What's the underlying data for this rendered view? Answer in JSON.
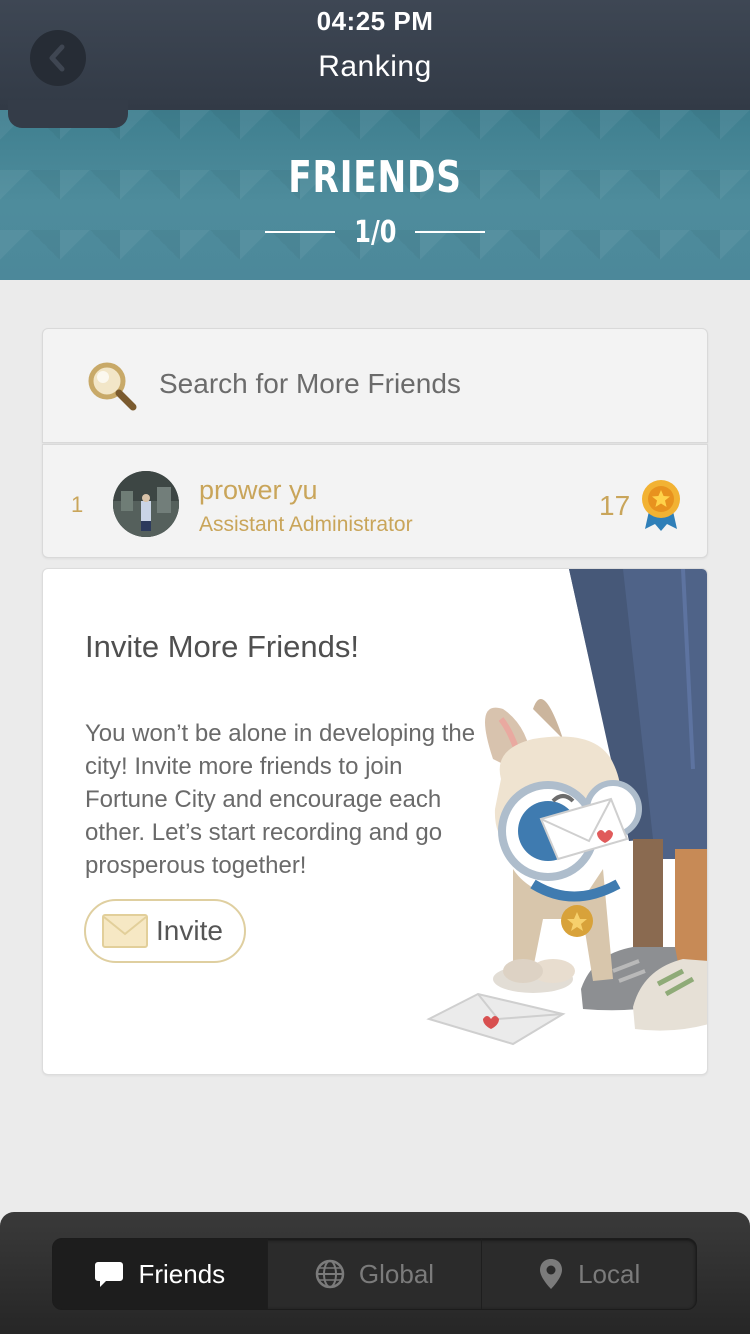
{
  "status_bar": {
    "time": "04:25 PM"
  },
  "header": {
    "title": "Ranking"
  },
  "banner": {
    "title": "FRIENDS",
    "count": "1/0"
  },
  "search": {
    "placeholder": "Search for More Friends"
  },
  "friends": [
    {
      "rank": "1",
      "name": "prower yu",
      "role": "Assistant Administrator",
      "score": "17"
    }
  ],
  "invite": {
    "title": "Invite More Friends!",
    "body": "You won’t be alone in developing the city! Invite more friends to join Fortune City and encourage each other. Let’s start recording and go prosperous together!",
    "button_label": "Invite"
  },
  "tabs": [
    {
      "label": "Friends",
      "icon": "chat-bubble-icon",
      "active": true
    },
    {
      "label": "Global",
      "icon": "globe-icon",
      "active": false
    },
    {
      "label": "Local",
      "icon": "location-pin-icon",
      "active": false
    }
  ],
  "colors": {
    "header_bg": "#3a424e",
    "banner_bg": "#4a8697",
    "accent_gold": "#c9a55a",
    "page_bg": "#ebebeb",
    "tabbar_bg": "#2b2b2b"
  }
}
